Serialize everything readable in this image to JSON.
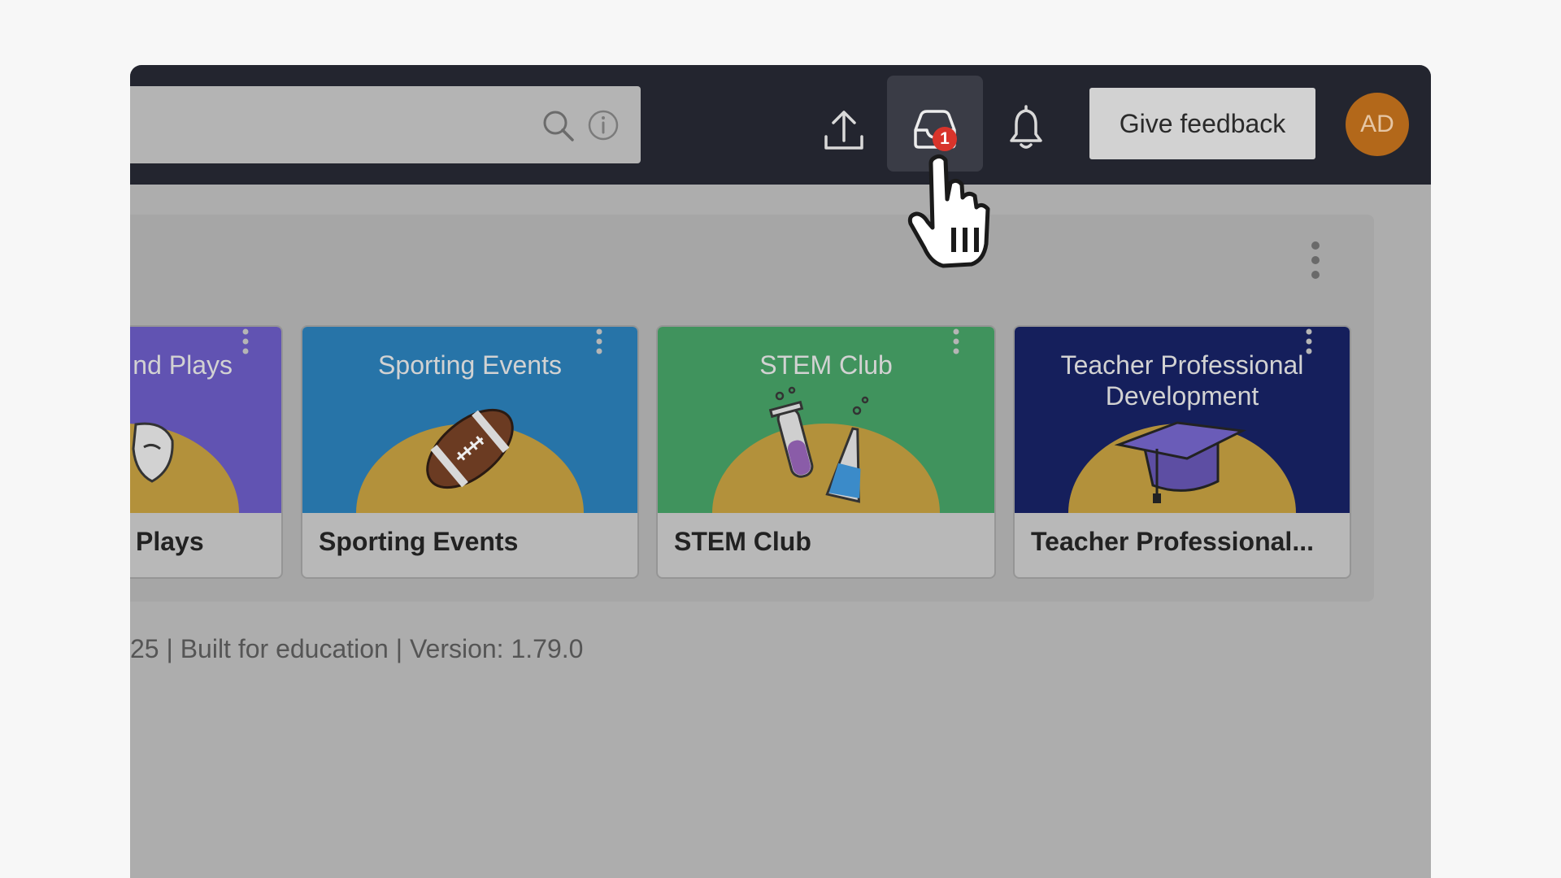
{
  "header": {
    "search": {
      "icon": "search-icon",
      "info_icon": "info-icon"
    },
    "actions": [
      {
        "name": "upload",
        "icon": "upload-icon"
      },
      {
        "name": "inbox",
        "icon": "inbox-icon",
        "badge": "1"
      },
      {
        "name": "notifications",
        "icon": "bell-icon"
      }
    ],
    "feedback_label": "Give feedback",
    "avatar_initials": "AD"
  },
  "cards": [
    {
      "banner_title": "nd Plays",
      "title": "Plays",
      "color": "#6153b2",
      "art": "theater-masks"
    },
    {
      "banner_title": "Sporting Events",
      "title": "Sporting Events",
      "color": "#2774a8",
      "art": "football"
    },
    {
      "banner_title": "STEM Club",
      "title": "STEM Club",
      "color": "#40935d",
      "art": "test-tubes"
    },
    {
      "banner_title": "Teacher Professional Development",
      "title": "Teacher Professional...",
      "color": "#151f5c",
      "art": "graduation-cap"
    }
  ],
  "footer": {
    "text": "25 | Built for education | Version: 1.79.0"
  },
  "colors": {
    "topbar": "#23252f",
    "badge": "#d8342b",
    "avatar": "#b3681a",
    "overlay": "#adadad"
  }
}
